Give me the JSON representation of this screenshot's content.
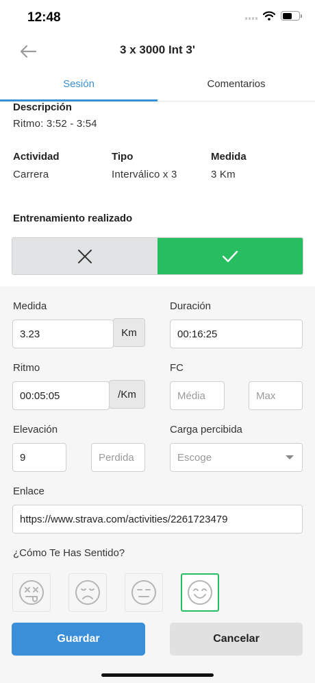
{
  "status_bar": {
    "time": "12:48"
  },
  "header": {
    "title": "3 x 3000 Int 3'"
  },
  "tabs": [
    {
      "label": "Sesión",
      "active": true
    },
    {
      "label": "Comentarios",
      "active": false
    }
  ],
  "description": {
    "label": "Descripción",
    "value": "Ritmo: 3:52 - 3:54"
  },
  "info": {
    "activity": {
      "label": "Actividad",
      "value": "Carrera"
    },
    "type": {
      "label": "Tipo",
      "value": "Interválico x 3"
    },
    "measure": {
      "label": "Medida",
      "value": "3 Km"
    }
  },
  "completed": {
    "label": "Entrenamiento realizado",
    "selected": "yes"
  },
  "form": {
    "distance": {
      "label": "Medida",
      "value": "3.23",
      "unit": "Km"
    },
    "duration": {
      "label": "Duración",
      "value": "00:16:25"
    },
    "pace": {
      "label": "Ritmo",
      "value": "00:05:05",
      "unit": "/Km"
    },
    "hr": {
      "label": "FC",
      "avg_placeholder": "Média",
      "max_placeholder": "Max"
    },
    "elevation": {
      "label": "Elevación",
      "value": "9",
      "loss_placeholder": "Perdida"
    },
    "perceived_load": {
      "label": "Carga percibida",
      "placeholder": "Escoge"
    },
    "link": {
      "label": "Enlace",
      "value": "https://www.strava.com/activities/2261723479"
    },
    "feeling": {
      "label": "¿Cómo Te Has Sentido?",
      "selected_index": 3
    }
  },
  "buttons": {
    "save": "Guardar",
    "cancel": "Cancelar"
  },
  "colors": {
    "accent": "#3a8fd6",
    "success": "#27be62",
    "save_button": "#3b8fd8"
  },
  "icons": [
    "back-arrow-icon",
    "x-icon",
    "checkmark-icon",
    "dizzy-face-icon",
    "sad-face-icon",
    "neutral-face-icon",
    "smiling-face-icon",
    "wifi-icon",
    "battery-icon",
    "signal-icon"
  ]
}
